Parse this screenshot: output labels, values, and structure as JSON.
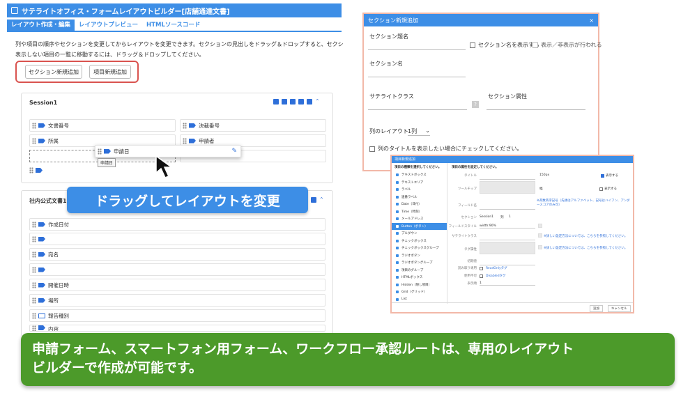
{
  "app": {
    "title": "サテライトオフィス・フォームレイアウトビルダー[店舗通達文書]"
  },
  "tabs": [
    "レイアウト作成・編集",
    "レイアウトプレビュー",
    "HTMLソースコード"
  ],
  "description": {
    "line1": "列や項目の順序やセクションを変更してからレイアウトを変更できます。セクションの見出しをドラッグ＆ドロップすると、セクションを並",
    "line2": "表示しない項目の一覧に移動するには、ドラッグ＆ドロップしてください。"
  },
  "buttons": {
    "add_section": "セクション新規追加",
    "add_item": "項目新規追加"
  },
  "session1": {
    "title": "Session1",
    "rows": [
      [
        "文書番号",
        "決裁番号"
      ],
      [
        "所属",
        "申請者"
      ]
    ],
    "dragging": "申請日",
    "drop_hint": "申請日"
  },
  "section2": {
    "title": "社内公式文書1",
    "rows": [
      "作成日付",
      "",
      "宛名",
      "",
      "開催日時",
      "場所",
      "報告種別",
      "内容"
    ]
  },
  "banner": "ドラッグしてレイアウトを変更",
  "caption": {
    "line1": "申請フォーム、スマートフォン用フォーム、ワークフロー承認ルートは、専用のレイアウト",
    "line2": "ビルダーで作成が可能です。"
  },
  "section_dialog": {
    "title": "セクション新規追加",
    "close": "×",
    "section_title_label": "セクション題名",
    "show_name": "セクション名を表示する",
    "show_toggle": "表示／非表示が行われる",
    "section_name_label": "セクション名",
    "satellite_class": "サテライトクラス",
    "help": "?",
    "section_attr": "セクション属性",
    "column_layout_label": "列のレイアウト",
    "column_layout_value": "1列",
    "column_title_check": "列のタイトルを表示したい場合にチェックしてください。"
  },
  "item_dialog": {
    "title": "項目新規追加",
    "left_header": "項目の種類を選択してください。",
    "right_header": "項目の属性を設定してください。",
    "types": [
      "テキストボックス",
      "テキストエリア",
      "ラベル",
      "連番ラベル",
      "Date（日付）",
      "Time（時刻）",
      "メールアドレス",
      "Button（ボタン）",
      "プルダウン",
      "チェックボックス",
      "チェックボックスグループ",
      "ラジオボタン",
      "ラジオボタングループ",
      "項目のグループ",
      "HTMLボックス",
      "Hidden（隠し項目）",
      "Grid（グリッド）",
      "List"
    ],
    "selected_index": 7,
    "fields": {
      "title_label": "タイトル",
      "width_value": "150px",
      "show_label": "表示する",
      "tooltip_label": "ツールチップ",
      "width_label": "幅",
      "show_label2": "表示する",
      "note": "※英数英字記号（先頭はアルファベット、記号はハイフン、アンダースコアのみ可）",
      "field_name_label": "フィールド名",
      "section_label": "セクション",
      "section_value": "Session1",
      "col_label": "列",
      "col_value": "1",
      "field_style_label": "フィールドスタイル",
      "field_style_value": "width:90%",
      "satellite_class_label": "サテライトクラス",
      "detail_link": "※詳しい設定方法については、こちらを参照してください。",
      "tag_attr_label": "タグ属性",
      "initial_label": "初期値",
      "readonly_label": "読み取り専用",
      "readonly_value": "ReadOnlyタグ",
      "disabled_label": "使用不可",
      "disabled_value": "Disabledタグ",
      "tab_order_label": "表示順",
      "tab_order_value": "1"
    },
    "ok": "追加",
    "cancel": "キャンセル"
  }
}
